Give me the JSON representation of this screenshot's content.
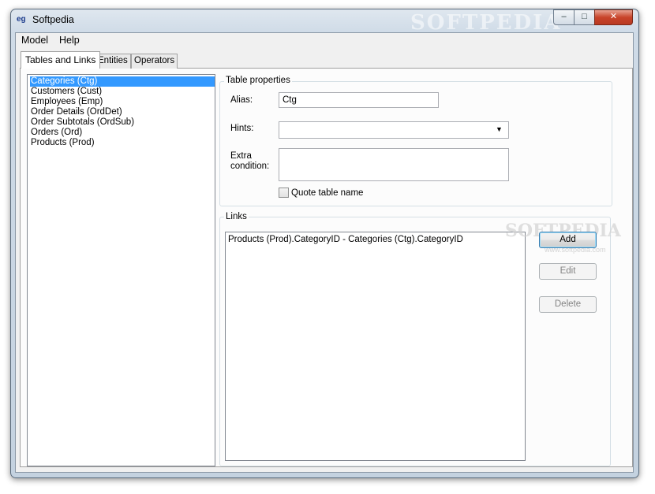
{
  "window": {
    "title": "Softpedia",
    "app_icon_text": "eg",
    "controls": {
      "minimize": "–",
      "maximize": "□",
      "close": "✕"
    },
    "watermark": "SOFTPEDIA"
  },
  "menubar": {
    "items": [
      "Model",
      "Help"
    ]
  },
  "tabs": [
    "Tables and Links",
    "Entities",
    "Operators"
  ],
  "tables": {
    "selected_index": 0,
    "items": [
      "Categories (Ctg)",
      "Customers (Cust)",
      "Employees (Emp)",
      "Order Details (OrdDet)",
      "Order Subtotals (OrdSub)",
      "Orders (Ord)",
      "Products (Prod)"
    ]
  },
  "table_properties": {
    "title": "Table properties",
    "alias_label": "Alias:",
    "alias_value": "Ctg",
    "hints_label": "Hints:",
    "hints_value": "",
    "hints_arrow": "▼",
    "extra_label_line1": "Extra",
    "extra_label_line2": "condition:",
    "extra_value": "",
    "quote_label": "Quote table name",
    "quote_checked": false
  },
  "links": {
    "title": "Links",
    "items": [
      "Products (Prod).CategoryID - Categories (Ctg).CategoryID"
    ],
    "buttons": {
      "add": "Add",
      "edit": "Edit",
      "delete": "Delete"
    },
    "watermark": "SOFTPEDIA",
    "watermark_url": "www.softpedia.com"
  },
  "colors": {
    "selection": "#3399ff",
    "window_frame": "#c4d2e0",
    "close_button": "#c8442a"
  }
}
